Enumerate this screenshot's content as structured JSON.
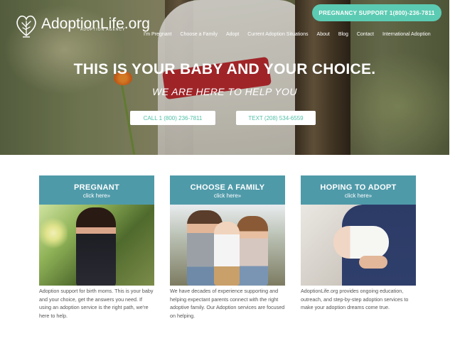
{
  "brand": {
    "name": "AdoptionLife.org",
    "tagline": "ADOPTION AGENCY",
    "accent_color": "#5ccbb3",
    "card_color": "#4f9aa9"
  },
  "header": {
    "support_label": "PREGNANCY SUPPORT 1(800)-236-7811",
    "nav": [
      {
        "label": "I'm Pregnant"
      },
      {
        "label": "Choose a Family"
      },
      {
        "label": "Adopt"
      },
      {
        "label": "Current Adoption Situations"
      },
      {
        "label": "About"
      },
      {
        "label": "Blog"
      },
      {
        "label": "Contact"
      },
      {
        "label": "International Adoption"
      }
    ]
  },
  "hero": {
    "headline": "THIS IS YOUR BABY AND YOUR CHOICE.",
    "subheadline": "WE ARE HERE TO HELP YOU",
    "call_label": "CALL 1 (800) 236-7811",
    "text_label": "TEXT (208) 534-6559"
  },
  "cards": [
    {
      "title": "PREGNANT",
      "link": "click here»",
      "text": "Adoption support for birth moms. This is your baby and your choice, get the answers you need. If using an adoption service is the right path, we're here to help."
    },
    {
      "title": "CHOOSE A FAMILY",
      "link": "click here»",
      "text": "We have decades of experience supporting and helping expectant parents connect with the right adoptive family. Our Adoption services are focused on helping."
    },
    {
      "title": "HOPING TO ADOPT",
      "link": "click here»",
      "text": "AdoptionLife.org provides ongoing education, outreach, and step-by-step adoption services to make your adoption dreams come true."
    }
  ]
}
